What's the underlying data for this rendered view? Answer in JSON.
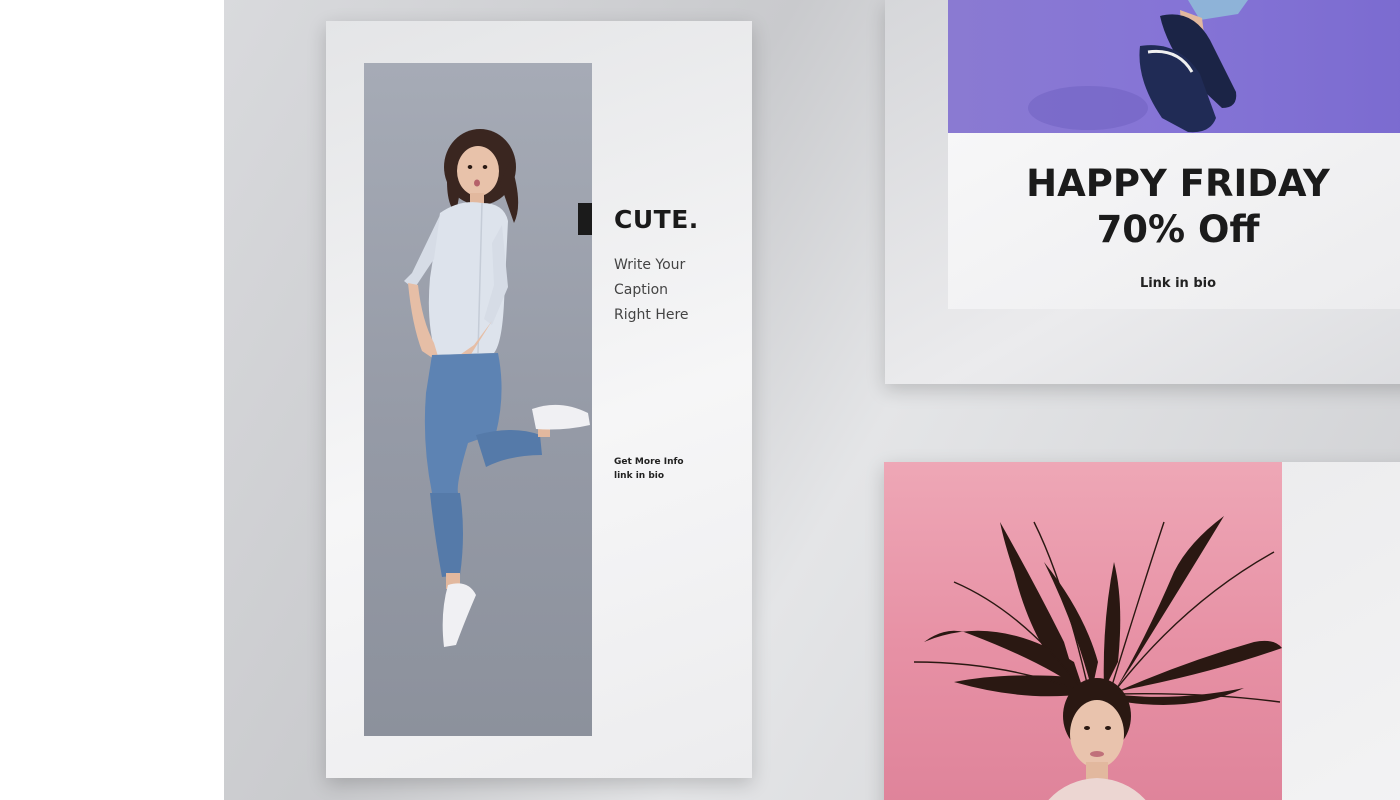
{
  "story_card": {
    "title": "CUTE.",
    "caption_lines": [
      "Write Your",
      "Caption",
      "Right Here"
    ],
    "info_lines": [
      "Get More Info",
      "link in bio"
    ],
    "photo_icon": "jumping-woman-photo"
  },
  "promo_card": {
    "title_lines": [
      "HAPPY FRIDAY",
      "70% Off"
    ],
    "link_text": "Link in bio",
    "photo_icon": "sneakers-photo"
  },
  "pink_card": {
    "photo_icon": "flying-hair-woman-photo"
  },
  "colors": {
    "stage_gray": "#cfd0d3",
    "story_photo_bg": "#9ca1ac",
    "promo_purple": "#8574d6",
    "pink_bg": "#e791a5",
    "text_dark": "#1b1b1b"
  }
}
